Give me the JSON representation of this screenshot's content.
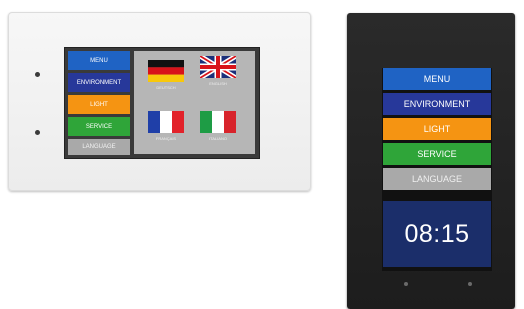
{
  "panel_small": {
    "menu": [
      "MENU",
      "ENVIRONMENT",
      "LIGHT",
      "SERVICE",
      "LANGUAGE"
    ],
    "flags": [
      {
        "icon": "germany-flag-icon",
        "caption": "DEUTSCH"
      },
      {
        "icon": "uk-flag-icon",
        "caption": "ENGLISH"
      },
      {
        "icon": "france-flag-icon",
        "caption": "FRANÇAIS"
      },
      {
        "icon": "italy-flag-icon",
        "caption": "ITALIANO"
      }
    ]
  },
  "panel_large": {
    "menu": [
      "MENU",
      "ENVIRONMENT",
      "LIGHT",
      "SERVICE",
      "LANGUAGE"
    ],
    "clock": "08:15"
  },
  "colors": {
    "menu": "#1f63c4",
    "environment": "#27389a",
    "light": "#f59412",
    "service": "#2fa539",
    "language": "#a9a9a9",
    "clock_bg": "#1b2e6a"
  }
}
